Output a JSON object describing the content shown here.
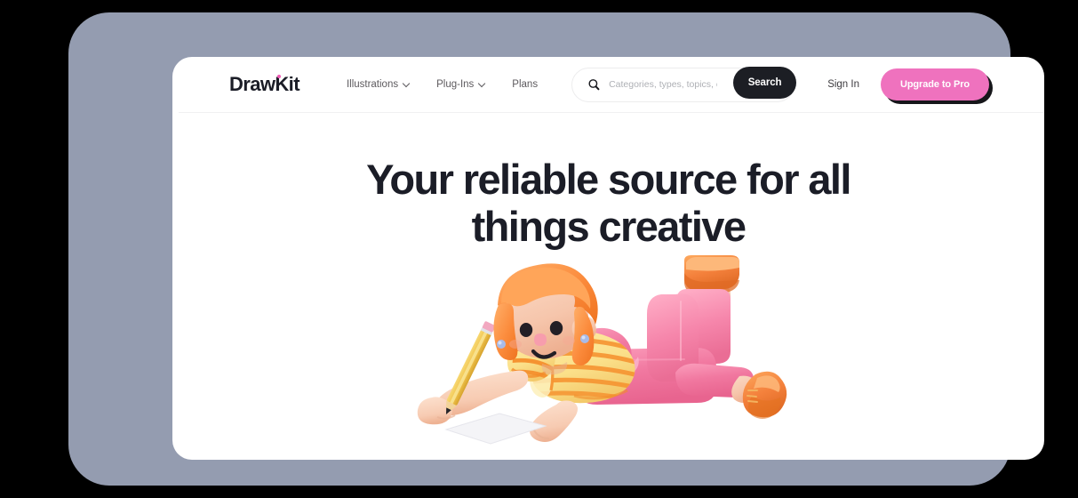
{
  "brand": {
    "logo_text": "DrawKit",
    "logo_dot_color": "#f05bb5",
    "text_color": "#1b1d27"
  },
  "nav": {
    "items": [
      {
        "label": "Illustrations",
        "has_dropdown": true,
        "icon": "chevron-down-icon"
      },
      {
        "label": "Plug-Ins",
        "has_dropdown": true,
        "icon": "chevron-down-icon"
      },
      {
        "label": "Plans",
        "has_dropdown": false,
        "icon": ""
      }
    ]
  },
  "search": {
    "icon": "search-icon",
    "placeholder": "Categories, types, topics, et",
    "value": "",
    "button_label": "Search",
    "button_color": "#1c1e24"
  },
  "actions": {
    "sign_in_label": "Sign In",
    "upgrade_label": "Upgrade to Pro",
    "upgrade_color": "#ef72be",
    "upgrade_shadow_color": "#16161a"
  },
  "hero": {
    "title_line_1": "Your reliable source for all",
    "title_line_2": "things creative",
    "illustration": {
      "name": "girl-drawing-3d-illustration",
      "description": "3D illustration of a girl lying on her stomach drawing on paper with a pencil",
      "colors": {
        "hair": "#fb8b3c",
        "skin": "#f6c6ac",
        "shirt": "#fbe08a",
        "shirt_stripes": "#f59331",
        "pants": "#f178a0",
        "shoes": "#f4813c",
        "pencil": "#f0c24a",
        "pencil_eraser": "#f2a8c0",
        "paper": "#f4f4f7",
        "earring": "#a8bbe8"
      }
    }
  },
  "frame": {
    "background_color": "#000000",
    "device_color": "#949cb0",
    "page_color": "#ffffff",
    "divider_color": "#f0f0f2"
  }
}
